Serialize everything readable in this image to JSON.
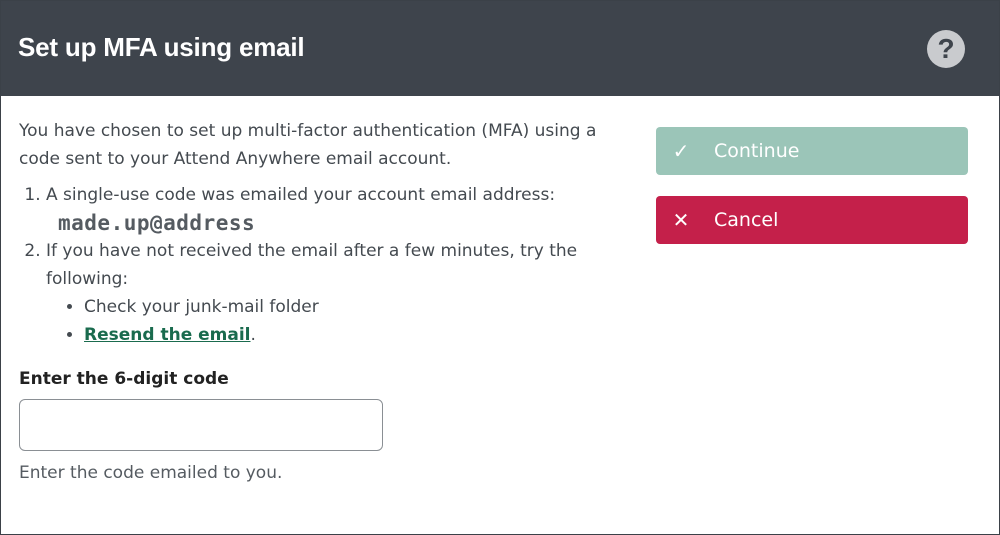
{
  "dialog": {
    "title": "Set up MFA using email",
    "help_glyph": "?"
  },
  "content": {
    "intro": "You have chosen to set up multi-factor authentication (MFA) using a code sent to your Attend Anywhere email account.",
    "step1": "A single-use code was emailed your account email address:",
    "email": "made.up@address",
    "step2": "If you have not received the email after a few minutes, try the following:",
    "bullet1": "Check your junk-mail folder",
    "resend_link": "Resend the email",
    "resend_suffix": ".",
    "code_label": "Enter the 6-digit code",
    "code_value": "",
    "code_hint": "Enter the code emailed to you."
  },
  "actions": {
    "continue_label": "Continue",
    "continue_icon": "✓",
    "cancel_label": "Cancel",
    "cancel_icon": "✕"
  },
  "colors": {
    "header_bg": "#3e444c",
    "continue_bg": "#9bc5b8",
    "cancel_bg": "#c4204a",
    "link": "#1a6b4e"
  }
}
